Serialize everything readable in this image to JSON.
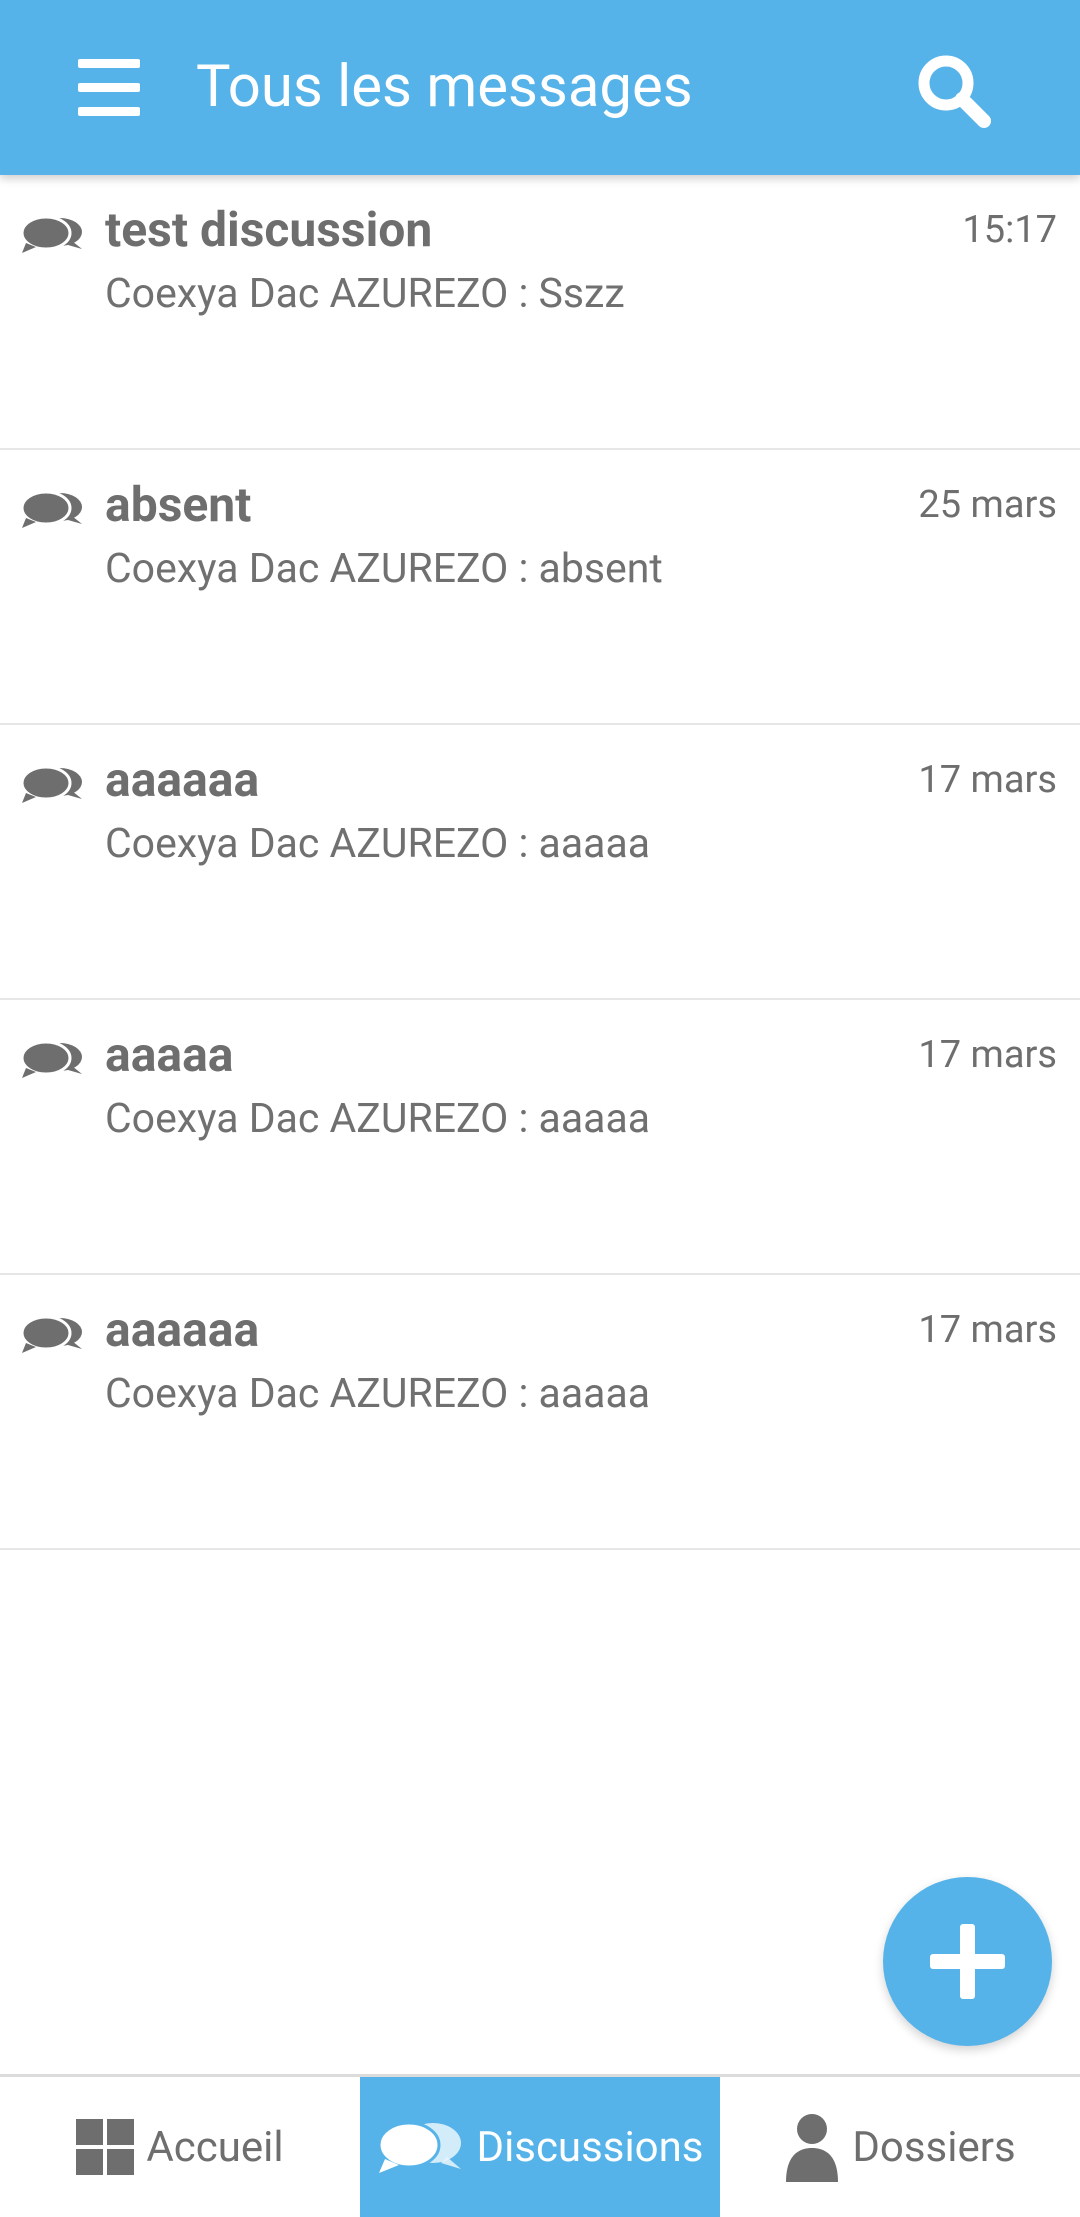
{
  "header": {
    "title": "Tous les messages",
    "menu_icon": "hamburger-menu-icon",
    "search_icon": "search-icon"
  },
  "discussions": [
    {
      "title": "test discussion",
      "preview": "Coexya Dac AZUREZO : Sszz",
      "date": "15:17",
      "icon": "chat-bubbles-icon"
    },
    {
      "title": "absent",
      "preview": "Coexya Dac AZUREZO : absent",
      "date": "25 mars",
      "icon": "chat-bubbles-icon"
    },
    {
      "title": "aaaaaa",
      "preview": "Coexya Dac AZUREZO : aaaaa",
      "date": "17 mars",
      "icon": "chat-bubbles-icon"
    },
    {
      "title": "aaaaa",
      "preview": "Coexya Dac AZUREZO : aaaaa",
      "date": "17 mars",
      "icon": "chat-bubbles-icon"
    },
    {
      "title": "aaaaaa",
      "preview": "Coexya Dac AZUREZO : aaaaa",
      "date": "17 mars",
      "icon": "chat-bubbles-icon"
    }
  ],
  "fab": {
    "icon": "plus-icon"
  },
  "bottom_nav": {
    "items": [
      {
        "label": "Accueil",
        "icon": "grid-icon",
        "active": false
      },
      {
        "label": "Discussions",
        "icon": "chat-bubbles-icon",
        "active": true
      },
      {
        "label": "Dossiers",
        "icon": "person-icon",
        "active": false
      }
    ]
  },
  "colors": {
    "primary": "#55b3e9",
    "text": "#6e6e6e",
    "divider": "#e6e6e6"
  }
}
